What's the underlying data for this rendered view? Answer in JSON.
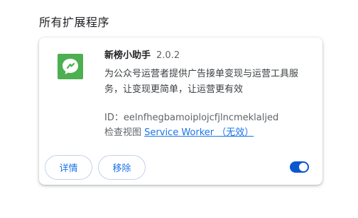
{
  "section": {
    "title": "所有扩展程序"
  },
  "extension": {
    "icon": "chat-bubble-icon",
    "icon_color": "#4caf50",
    "name": "新榜小助手",
    "version": "2.0.2",
    "description": "为公众号运营者提供广告接单变现与运营工具服务，让变现更简单，让运营更有效",
    "id_label": "ID：",
    "id_value": "eelnfhegbamoiplojcfjlncmeklaljed",
    "inspect_label": "检查视图",
    "inspect_link": "Service Worker （无效）",
    "enabled": true
  },
  "actions": {
    "details_label": "详情",
    "remove_label": "移除"
  },
  "colors": {
    "accent": "#1a73e8",
    "toggle_on": "#0b57d0"
  }
}
